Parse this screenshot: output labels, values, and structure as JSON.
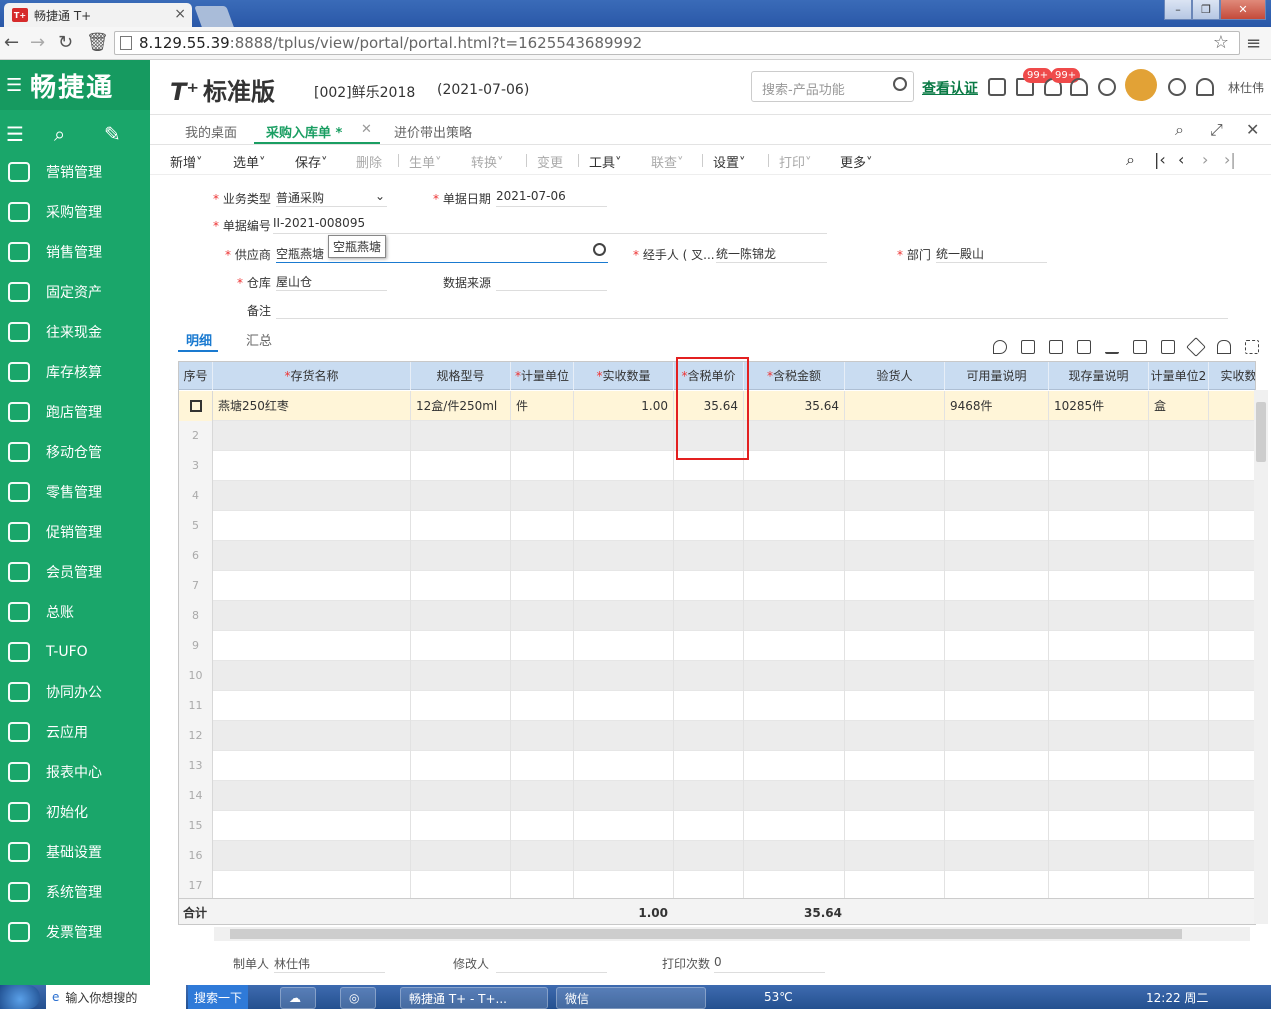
{
  "browser": {
    "tab_title": "畅捷通 T+",
    "favicon_text": "T+",
    "url_host": "8.129.55.39",
    "url_rest": ":8888/tplus/view/portal/portal.html?t=1625543689992"
  },
  "sidebar": {
    "brand": "畅捷通",
    "items": [
      {
        "label": "营销管理"
      },
      {
        "label": "采购管理"
      },
      {
        "label": "销售管理"
      },
      {
        "label": "固定资产"
      },
      {
        "label": "往来现金"
      },
      {
        "label": "库存核算"
      },
      {
        "label": "跑店管理"
      },
      {
        "label": "移动仓管"
      },
      {
        "label": "零售管理"
      },
      {
        "label": "促销管理"
      },
      {
        "label": "会员管理"
      },
      {
        "label": "总账"
      },
      {
        "label": "T-UFO"
      },
      {
        "label": "协同办公"
      },
      {
        "label": "云应用"
      },
      {
        "label": "报表中心"
      },
      {
        "label": "初始化"
      },
      {
        "label": "基础设置"
      },
      {
        "label": "系统管理"
      },
      {
        "label": "发票管理"
      }
    ]
  },
  "header": {
    "logo": "T⁺",
    "edition": "标准版",
    "account": "[002]鲜乐2018",
    "date": "(2021-07-06)",
    "search_placeholder": "搜索-产品功能",
    "verify_link": "查看认证",
    "badge1": "99+",
    "badge2": "99+",
    "user": "林仕伟"
  },
  "page_tabs": {
    "desk": "我的桌面",
    "active": "采购入库单 *",
    "strategy": "进价带出策略"
  },
  "toolbar": {
    "new": "新增",
    "select": "选单",
    "save": "保存",
    "delete": "删除",
    "gen": "生单",
    "convert": "转换",
    "change": "变更",
    "tools": "工具",
    "link": "联查",
    "settings": "设置",
    "print": "打印",
    "more": "更多"
  },
  "form": {
    "biz_type_label": "业务类型",
    "biz_type": "普通采购",
    "doc_date_label": "单据日期",
    "doc_date": "2021-07-06",
    "doc_no_label": "单据编号",
    "doc_no": "II-2021-008095",
    "supplier_label": "供应商",
    "supplier": "空瓶燕塘",
    "supplier_tip": "空瓶燕塘",
    "handler_label": "经手人 ( 叉...",
    "handler": "统一陈锦龙",
    "dept_label": "部门",
    "dept": "统一殿山",
    "warehouse_label": "仓库",
    "warehouse": "屋山仓",
    "source_label": "数据来源",
    "remark_label": "备注"
  },
  "subtabs": {
    "detail": "明细",
    "summary": "汇总"
  },
  "grid": {
    "headers": [
      "序号",
      "存货名称",
      "规格型号",
      "计量单位",
      "实收数量",
      "含税单价",
      "含税金额",
      "验货人",
      "可用量说明",
      "现存量说明",
      "计量单位2",
      "实收数"
    ],
    "row1": {
      "name": "燕塘250红枣",
      "spec": "12盒/件250ml",
      "unit": "件",
      "qty": "1.00",
      "price": "35.64",
      "amount": "35.64",
      "inspector": "",
      "avail": "9468件",
      "stock": "10285件",
      "unit2": "盒"
    },
    "row_numbers": [
      "2",
      "3",
      "4",
      "5",
      "6",
      "7",
      "8",
      "9",
      "10",
      "11",
      "12",
      "13",
      "14",
      "15",
      "16",
      "17"
    ],
    "total_label": "合计",
    "total_qty": "1.00",
    "total_amount": "35.64"
  },
  "footer": {
    "maker_label": "制单人",
    "maker": "林仕伟",
    "modifier_label": "修改人",
    "print_label": "打印次数",
    "print_count": "0"
  },
  "taskbar": {
    "search_hint": "输入你想搜的",
    "search_btn": "搜索一下",
    "app1": "畅捷通 T+ - T+...",
    "app2": "微信",
    "temp": "53℃",
    "time": "12:22 周二"
  }
}
